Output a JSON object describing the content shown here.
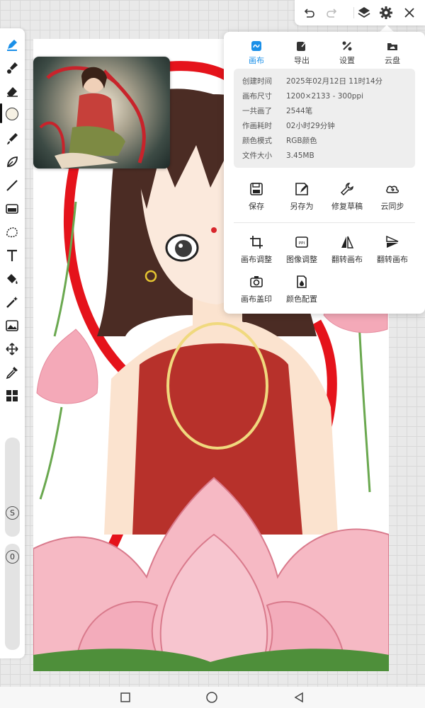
{
  "topbar": {
    "undo_icon": "undo-icon",
    "redo_icon": "redo-icon",
    "layers_icon": "layers-icon",
    "settings_icon": "gear-icon",
    "close_icon": "close-icon"
  },
  "toolbar": {
    "tools": [
      "pen-tool",
      "brush-tool",
      "eraser-tool",
      "color-picker",
      "smudge-tool",
      "lasso-tool",
      "line-tool",
      "gradient-tool",
      "selection-tool",
      "text-tool",
      "fill-tool",
      "magic-wand-tool",
      "image-tool",
      "transform-tool",
      "eyedropper-tool",
      "more-tools"
    ],
    "size_badge": "S",
    "opacity_badge": "0"
  },
  "panel": {
    "tabs": [
      {
        "label": "画布",
        "icon": "canvas-icon",
        "active": true
      },
      {
        "label": "导出",
        "icon": "export-icon",
        "active": false
      },
      {
        "label": "设置",
        "icon": "settings-icon",
        "active": false
      },
      {
        "label": "云盘",
        "icon": "cloud-drive-icon",
        "active": false
      }
    ],
    "info": [
      {
        "key": "创建时间",
        "value": "2025年02月12日 11时14分"
      },
      {
        "key": "画布尺寸",
        "value": "1200×2133 - 300ppi"
      },
      {
        "key": "一共画了",
        "value": "2544笔"
      },
      {
        "key": "作画耗时",
        "value": "02小时29分钟"
      },
      {
        "key": "颜色模式",
        "value": "RGB颜色"
      },
      {
        "key": "文件大小",
        "value": "3.45MB"
      }
    ],
    "actions_row1": [
      {
        "label": "保存",
        "icon": "save-icon"
      },
      {
        "label": "另存为",
        "icon": "save-as-icon"
      },
      {
        "label": "修复草稿",
        "icon": "wrench-icon"
      },
      {
        "label": "云同步",
        "icon": "cloud-sync-icon"
      }
    ],
    "actions_row2": [
      {
        "label": "画布调整",
        "icon": "crop-icon"
      },
      {
        "label": "图像调整",
        "icon": "ppi-icon"
      },
      {
        "label": "翻转画布",
        "icon": "flip-horizontal-icon"
      },
      {
        "label": "翻转画布",
        "icon": "flip-vertical-icon"
      }
    ],
    "actions_row3": [
      {
        "label": "画布盖印",
        "icon": "stamp-icon"
      },
      {
        "label": "颜色配置",
        "icon": "color-config-icon"
      }
    ]
  },
  "colors": {
    "accent": "#1a8fe8",
    "panel_bg": "#ffffff",
    "info_bg": "#eeeeee"
  }
}
